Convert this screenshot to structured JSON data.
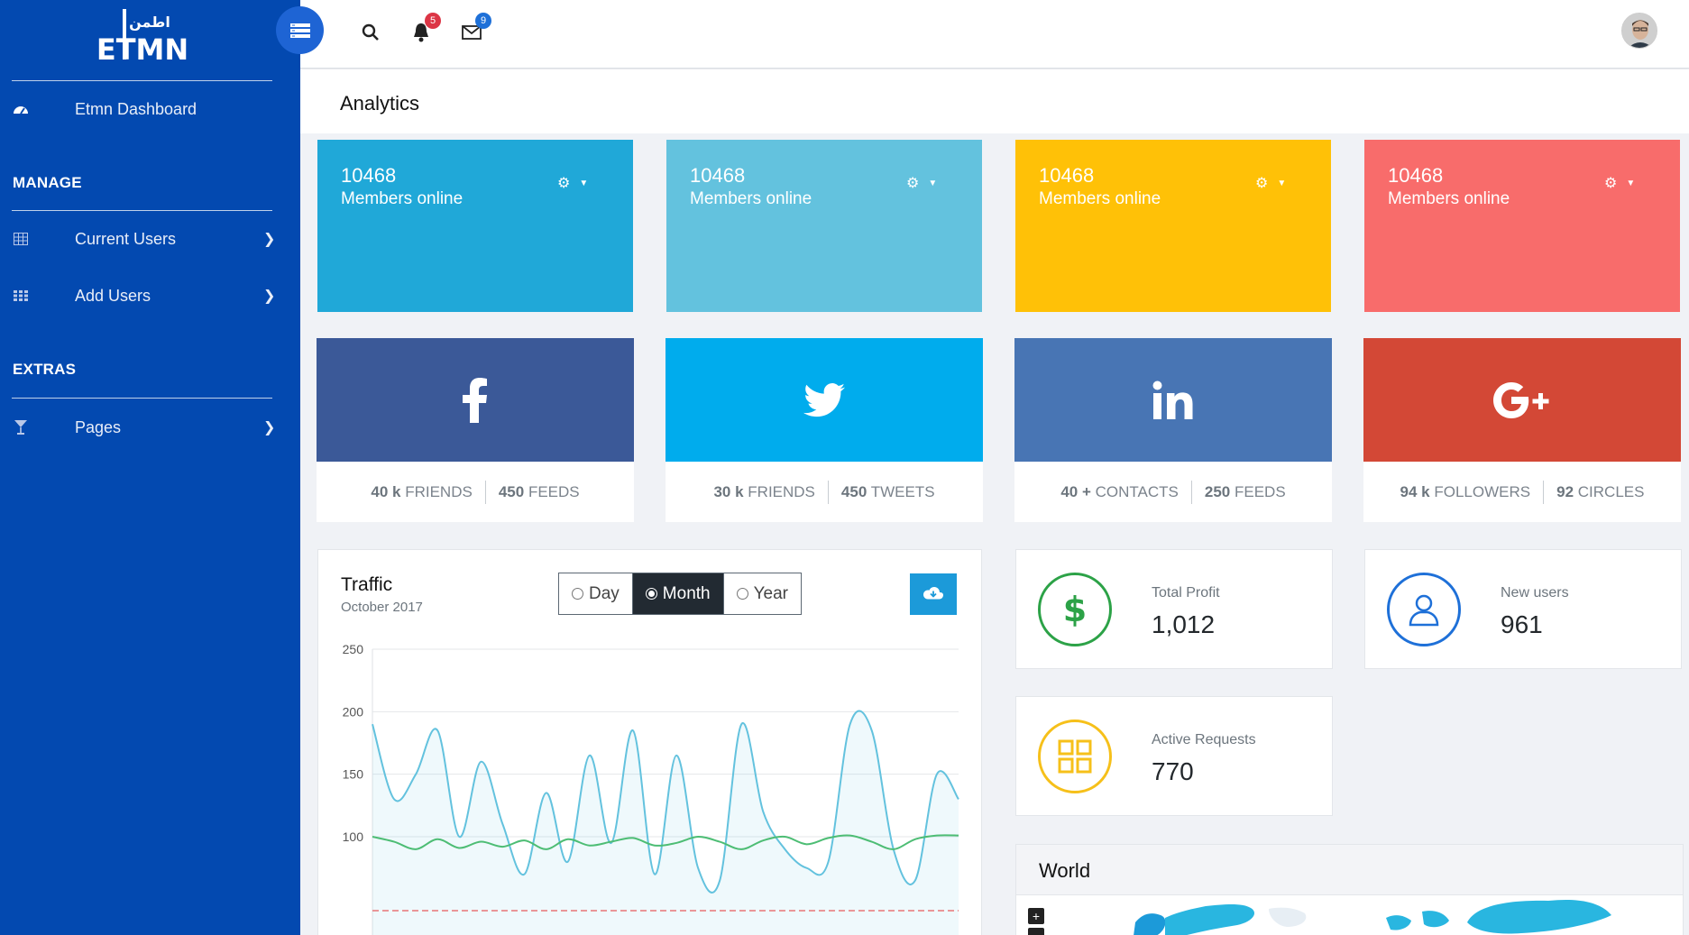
{
  "sidebar": {
    "logo_text": "ETMN",
    "logo_arabic": "اطمن",
    "dashboard_label": "Etmn Dashboard",
    "sections": [
      {
        "title": "MANAGE"
      },
      {
        "title": "EXTRAS"
      }
    ],
    "items": [
      {
        "label": "Current Users",
        "icon": "table-icon"
      },
      {
        "label": "Add Users",
        "icon": "grid-icon"
      },
      {
        "label": "Pages",
        "icon": "cocktail-icon"
      }
    ]
  },
  "topbar": {
    "notifications_count": "5",
    "messages_count": "9"
  },
  "page": {
    "title": "Analytics"
  },
  "stat_cards": [
    {
      "number": "10468",
      "label": "Members online",
      "color": "#20a8d8"
    },
    {
      "number": "10468",
      "label": "Members online",
      "color": "#63c2de"
    },
    {
      "number": "10468",
      "label": "Members online",
      "color": "#ffc107"
    },
    {
      "number": "10468",
      "label": "Members online",
      "color": "#f86c6b"
    }
  ],
  "social": [
    {
      "network": "facebook",
      "color": "#3b5998",
      "a_num": "40 k",
      "a_label": "FRIENDS",
      "b_num": "450",
      "b_label": "FEEDS"
    },
    {
      "network": "twitter",
      "color": "#00aced",
      "a_num": "30 k",
      "a_label": "FRIENDS",
      "b_num": "450",
      "b_label": "TWEETS"
    },
    {
      "network": "linkedin",
      "color": "#4875b4",
      "a_num": "40 +",
      "a_label": "CONTACTS",
      "b_num": "250",
      "b_label": "FEEDS"
    },
    {
      "network": "google-plus",
      "color": "#d34836",
      "a_num": "94 k",
      "a_label": "FOLLOWERS",
      "b_num": "92",
      "b_label": "CIRCLES"
    }
  ],
  "traffic": {
    "title": "Traffic",
    "subtitle": "October 2017",
    "options": [
      "Day",
      "Month",
      "Year"
    ],
    "selected": "Month"
  },
  "chart_data": {
    "type": "area",
    "ylim": [
      50,
      250
    ],
    "yticks": [
      250,
      200,
      150,
      100
    ],
    "grid": true,
    "series": [
      {
        "color": "#63c2de",
        "values": [
          190,
          130,
          150,
          185,
          100,
          160,
          110,
          70,
          135,
          80,
          165,
          95,
          185,
          70,
          165,
          75,
          65,
          190,
          120,
          90,
          75,
          80,
          190,
          185,
          90,
          65,
          150,
          130
        ]
      },
      {
        "color": "#4dbd74",
        "values": [
          100,
          96,
          90,
          98,
          91,
          96,
          92,
          97,
          90,
          98,
          93,
          96,
          99,
          93,
          95,
          100,
          96,
          90,
          97,
          100,
          94,
          99,
          101,
          96,
          90,
          98,
          101,
          101
        ]
      }
    ]
  },
  "info_cards": [
    {
      "label": "Total Profit",
      "value": "1,012",
      "color": "#2ca247",
      "icon": "dollar-icon"
    },
    {
      "label": "New users",
      "value": "961",
      "color": "#1e70d8",
      "icon": "user-icon"
    },
    {
      "label": "Active Requests",
      "value": "770",
      "color": "#f6c01a",
      "icon": "apps-icon"
    }
  ],
  "world": {
    "title": "World"
  }
}
